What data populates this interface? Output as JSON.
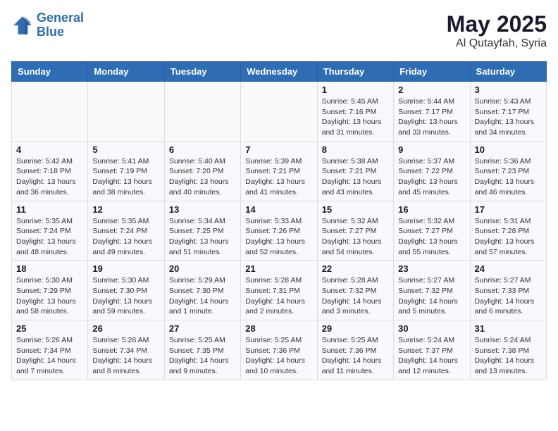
{
  "header": {
    "logo_line1": "General",
    "logo_line2": "Blue",
    "title": "May 2025",
    "subtitle": "Al Qutayfah, Syria"
  },
  "weekdays": [
    "Sunday",
    "Monday",
    "Tuesday",
    "Wednesday",
    "Thursday",
    "Friday",
    "Saturday"
  ],
  "weeks": [
    [
      {
        "day": "",
        "info": ""
      },
      {
        "day": "",
        "info": ""
      },
      {
        "day": "",
        "info": ""
      },
      {
        "day": "",
        "info": ""
      },
      {
        "day": "1",
        "info": "Sunrise: 5:45 AM\nSunset: 7:16 PM\nDaylight: 13 hours\nand 31 minutes."
      },
      {
        "day": "2",
        "info": "Sunrise: 5:44 AM\nSunset: 7:17 PM\nDaylight: 13 hours\nand 33 minutes."
      },
      {
        "day": "3",
        "info": "Sunrise: 5:43 AM\nSunset: 7:17 PM\nDaylight: 13 hours\nand 34 minutes."
      }
    ],
    [
      {
        "day": "4",
        "info": "Sunrise: 5:42 AM\nSunset: 7:18 PM\nDaylight: 13 hours\nand 36 minutes."
      },
      {
        "day": "5",
        "info": "Sunrise: 5:41 AM\nSunset: 7:19 PM\nDaylight: 13 hours\nand 38 minutes."
      },
      {
        "day": "6",
        "info": "Sunrise: 5:40 AM\nSunset: 7:20 PM\nDaylight: 13 hours\nand 40 minutes."
      },
      {
        "day": "7",
        "info": "Sunrise: 5:39 AM\nSunset: 7:21 PM\nDaylight: 13 hours\nand 41 minutes."
      },
      {
        "day": "8",
        "info": "Sunrise: 5:38 AM\nSunset: 7:21 PM\nDaylight: 13 hours\nand 43 minutes."
      },
      {
        "day": "9",
        "info": "Sunrise: 5:37 AM\nSunset: 7:22 PM\nDaylight: 13 hours\nand 45 minutes."
      },
      {
        "day": "10",
        "info": "Sunrise: 5:36 AM\nSunset: 7:23 PM\nDaylight: 13 hours\nand 46 minutes."
      }
    ],
    [
      {
        "day": "11",
        "info": "Sunrise: 5:35 AM\nSunset: 7:24 PM\nDaylight: 13 hours\nand 48 minutes."
      },
      {
        "day": "12",
        "info": "Sunrise: 5:35 AM\nSunset: 7:24 PM\nDaylight: 13 hours\nand 49 minutes."
      },
      {
        "day": "13",
        "info": "Sunrise: 5:34 AM\nSunset: 7:25 PM\nDaylight: 13 hours\nand 51 minutes."
      },
      {
        "day": "14",
        "info": "Sunrise: 5:33 AM\nSunset: 7:26 PM\nDaylight: 13 hours\nand 52 minutes."
      },
      {
        "day": "15",
        "info": "Sunrise: 5:32 AM\nSunset: 7:27 PM\nDaylight: 13 hours\nand 54 minutes."
      },
      {
        "day": "16",
        "info": "Sunrise: 5:32 AM\nSunset: 7:27 PM\nDaylight: 13 hours\nand 55 minutes."
      },
      {
        "day": "17",
        "info": "Sunrise: 5:31 AM\nSunset: 7:28 PM\nDaylight: 13 hours\nand 57 minutes."
      }
    ],
    [
      {
        "day": "18",
        "info": "Sunrise: 5:30 AM\nSunset: 7:29 PM\nDaylight: 13 hours\nand 58 minutes."
      },
      {
        "day": "19",
        "info": "Sunrise: 5:30 AM\nSunset: 7:30 PM\nDaylight: 13 hours\nand 59 minutes."
      },
      {
        "day": "20",
        "info": "Sunrise: 5:29 AM\nSunset: 7:30 PM\nDaylight: 14 hours\nand 1 minute."
      },
      {
        "day": "21",
        "info": "Sunrise: 5:28 AM\nSunset: 7:31 PM\nDaylight: 14 hours\nand 2 minutes."
      },
      {
        "day": "22",
        "info": "Sunrise: 5:28 AM\nSunset: 7:32 PM\nDaylight: 14 hours\nand 3 minutes."
      },
      {
        "day": "23",
        "info": "Sunrise: 5:27 AM\nSunset: 7:32 PM\nDaylight: 14 hours\nand 5 minutes."
      },
      {
        "day": "24",
        "info": "Sunrise: 5:27 AM\nSunset: 7:33 PM\nDaylight: 14 hours\nand 6 minutes."
      }
    ],
    [
      {
        "day": "25",
        "info": "Sunrise: 5:26 AM\nSunset: 7:34 PM\nDaylight: 14 hours\nand 7 minutes."
      },
      {
        "day": "26",
        "info": "Sunrise: 5:26 AM\nSunset: 7:34 PM\nDaylight: 14 hours\nand 8 minutes."
      },
      {
        "day": "27",
        "info": "Sunrise: 5:25 AM\nSunset: 7:35 PM\nDaylight: 14 hours\nand 9 minutes."
      },
      {
        "day": "28",
        "info": "Sunrise: 5:25 AM\nSunset: 7:36 PM\nDaylight: 14 hours\nand 10 minutes."
      },
      {
        "day": "29",
        "info": "Sunrise: 5:25 AM\nSunset: 7:36 PM\nDaylight: 14 hours\nand 11 minutes."
      },
      {
        "day": "30",
        "info": "Sunrise: 5:24 AM\nSunset: 7:37 PM\nDaylight: 14 hours\nand 12 minutes."
      },
      {
        "day": "31",
        "info": "Sunrise: 5:24 AM\nSunset: 7:38 PM\nDaylight: 14 hours\nand 13 minutes."
      }
    ]
  ]
}
